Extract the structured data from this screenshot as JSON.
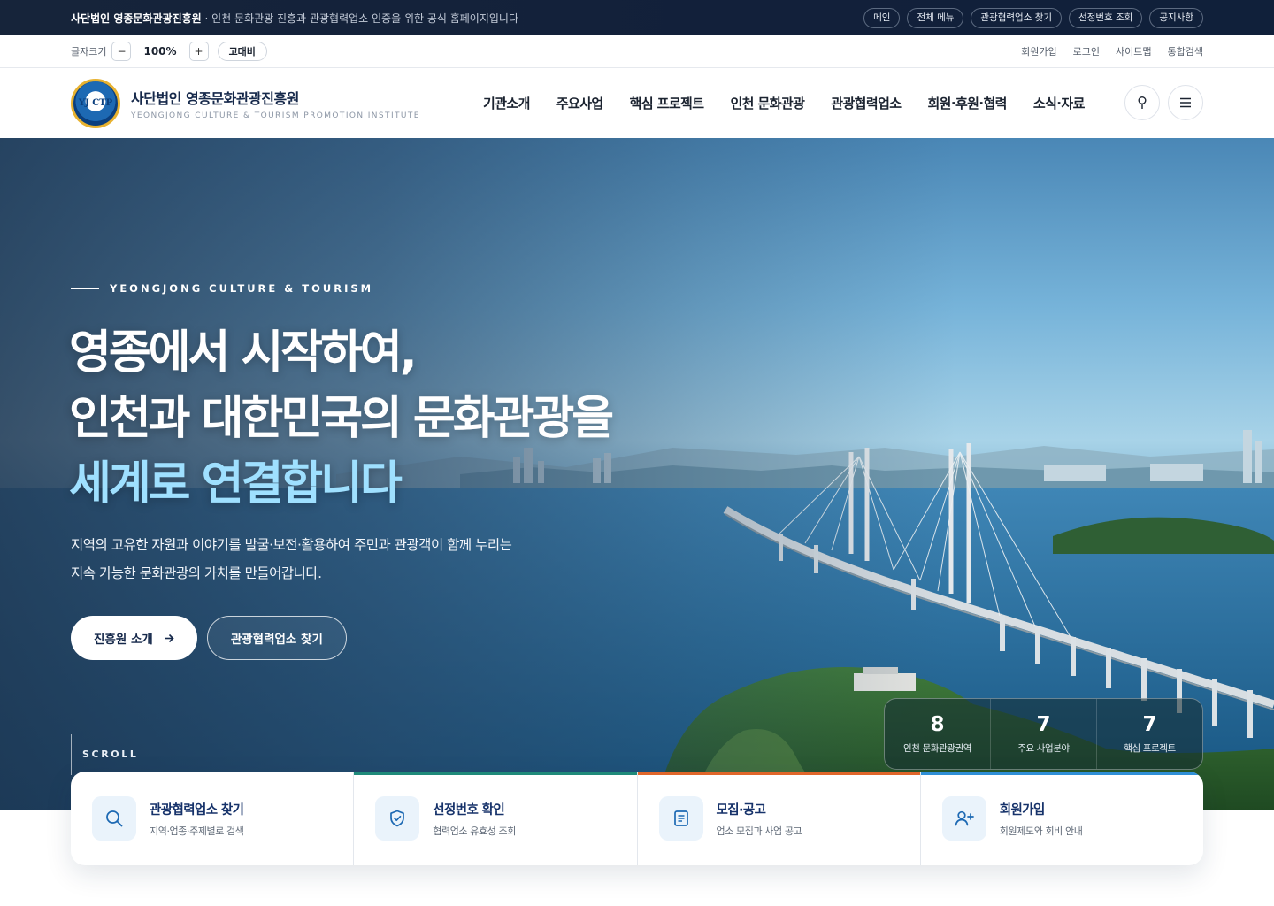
{
  "topbar": {
    "org_name": "사단법인 영종문화관광진흥원",
    "tagline": " · 인천 문화관광 진흥과 관광협력업소 인증을 위한 공식 홈페이지입니다",
    "quick_links": [
      "메인",
      "전체 메뉴",
      "관광협력업소 찾기",
      "선정번호 조회",
      "공지사항"
    ]
  },
  "utility": {
    "font_size_label": "글자크기",
    "decrease": "−",
    "zoom": "100%",
    "increase": "+",
    "contrast": "고대비",
    "links": [
      "회원가입",
      "로그인",
      "사이트맵",
      "통합검색"
    ]
  },
  "header": {
    "logo_mark": "YJ CTP",
    "org_name": "사단법인 영종문화관광진흥원",
    "org_name_en": "YEONGJONG CULTURE & TOURISM PROMOTION INSTITUTE",
    "nav": [
      "기관소개",
      "주요사업",
      "핵심 프로젝트",
      "인천 문화관광",
      "관광협력업소",
      "회원·후원·협력",
      "소식·자료"
    ]
  },
  "hero": {
    "eyebrow": "YEONGJONG CULTURE & TOURISM",
    "headline_line1": "영종에서 시작하여,",
    "headline_line2": "인천과 대한민국의 문화관광을",
    "headline_line3": "세계로 연결합니다",
    "sub_line1": "지역의 고유한 자원과 이야기를 발굴·보전·활용하여 주민과 관광객이 함께 누리는",
    "sub_line2": "지속 가능한 문화관광의 가치를 만들어갑니다.",
    "cta_primary": "진흥원 소개",
    "cta_secondary": "관광협력업소 찾기",
    "scroll_label": "SCROLL",
    "stats": [
      {
        "value": "8",
        "label": "인천 문화관광권역"
      },
      {
        "value": "7",
        "label": "주요 사업분야"
      },
      {
        "value": "7",
        "label": "핵심 프로젝트"
      }
    ]
  },
  "quick_cards": [
    {
      "title": "관광협력업소 찾기",
      "desc": "지역·업종·주제별로 검색",
      "icon": "search-icon",
      "accent": ""
    },
    {
      "title": "선정번호 확인",
      "desc": "협력업소 유효성 조회",
      "icon": "shield-check-icon",
      "accent": "#1f8a7a"
    },
    {
      "title": "모집·공고",
      "desc": "업소 모집과 사업 공고",
      "icon": "document-icon",
      "accent": "#e0662a"
    },
    {
      "title": "회원가입",
      "desc": "회원제도와 회비 안내",
      "icon": "user-add-icon",
      "accent": "#2f8fd6"
    }
  ],
  "colors": {
    "navy": "#15284a",
    "accent_sky": "#9fe0ff",
    "icon_blue": "#1d69b3"
  }
}
